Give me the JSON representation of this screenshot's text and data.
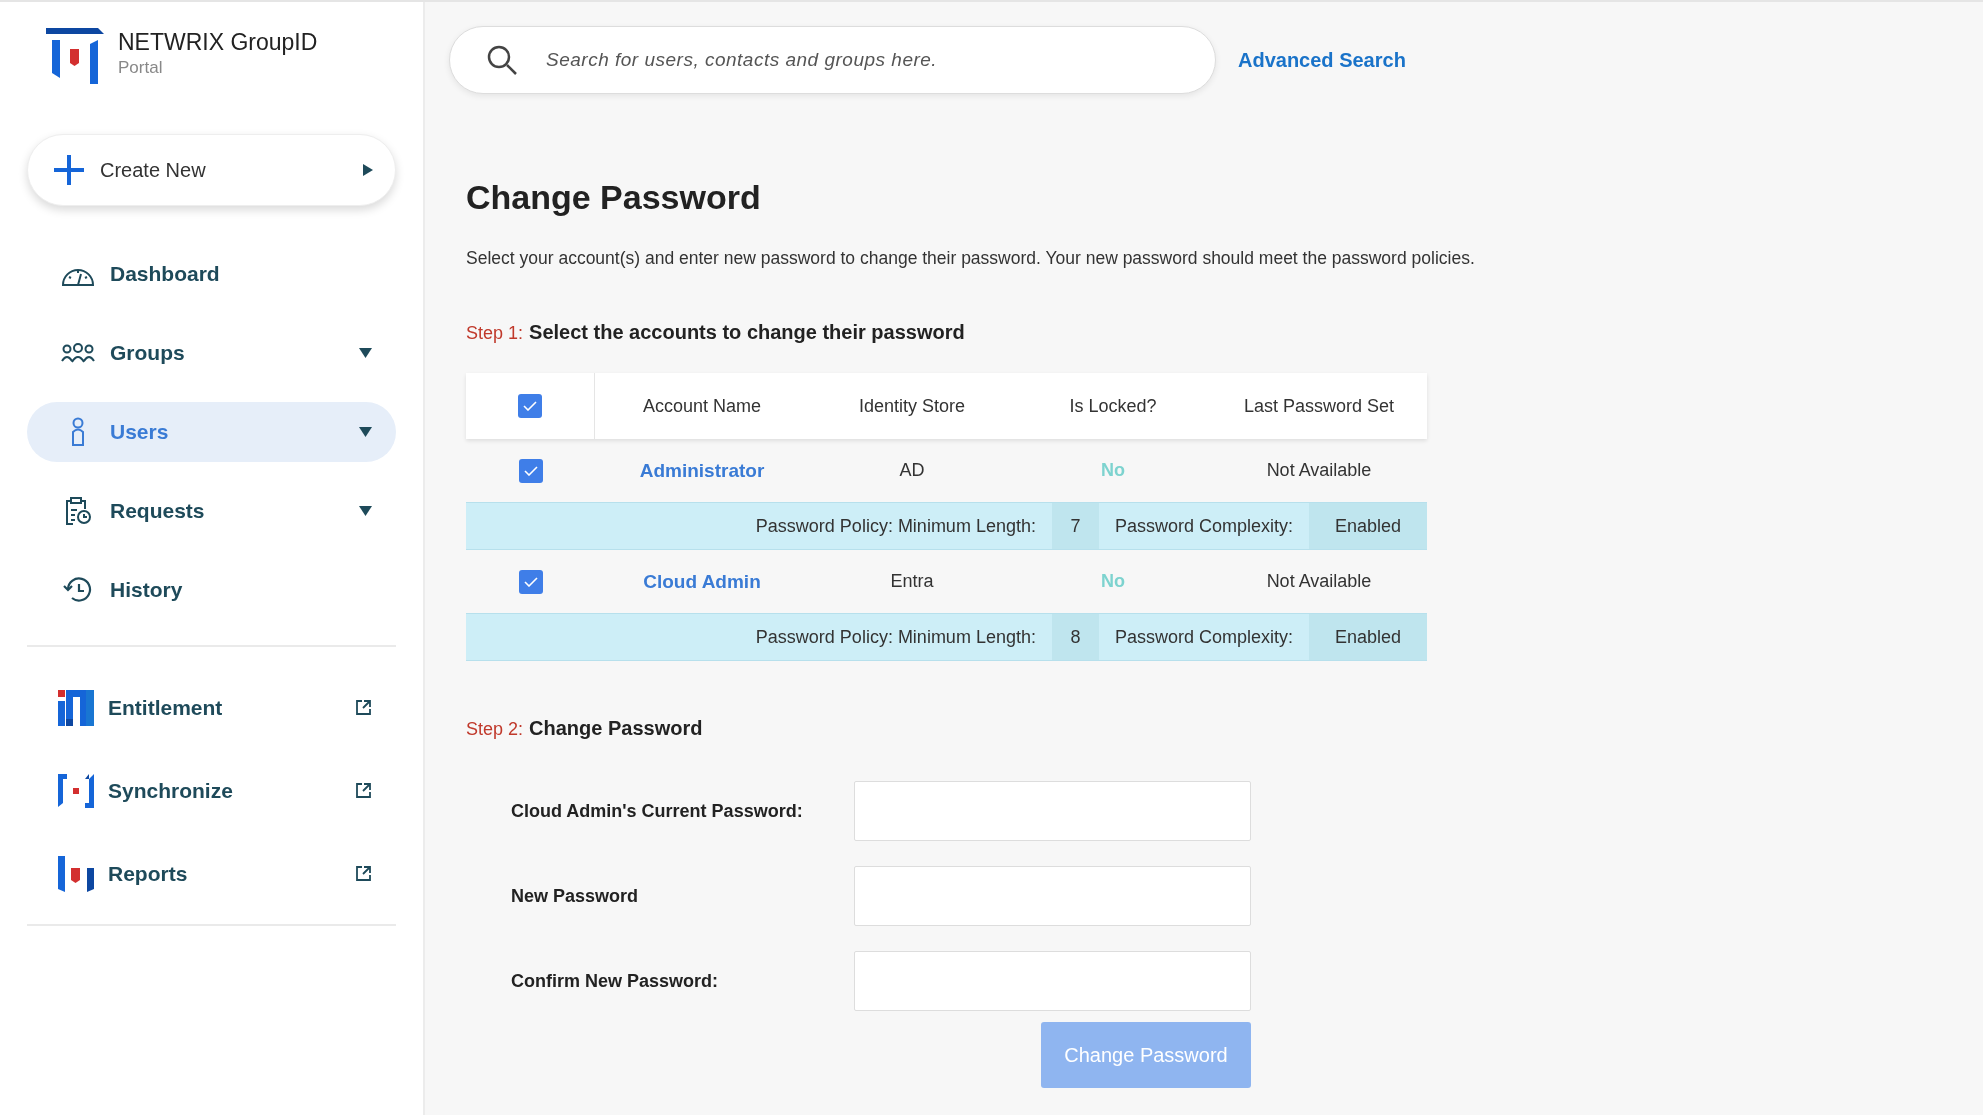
{
  "brand": {
    "title": "NETWRIX GroupID",
    "subtitle": "Portal"
  },
  "create_button": {
    "label": "Create New"
  },
  "sidebar": {
    "items": [
      {
        "label": "Dashboard",
        "kind": "dashboard",
        "selected": false
      },
      {
        "label": "Groups",
        "kind": "groups",
        "selected": false,
        "expandable": true
      },
      {
        "label": "Users",
        "kind": "users",
        "selected": true,
        "expandable": true
      },
      {
        "label": "Requests",
        "kind": "requests",
        "selected": false,
        "expandable": true
      },
      {
        "label": "History",
        "kind": "history",
        "selected": false
      }
    ],
    "apps": [
      {
        "label": "Entitlement",
        "kind": "entitlement"
      },
      {
        "label": "Synchronize",
        "kind": "synchronize"
      },
      {
        "label": "Reports",
        "kind": "reports"
      }
    ]
  },
  "search": {
    "placeholder": "Search for users, contacts and groups here.",
    "advanced_link": "Advanced Search"
  },
  "page": {
    "title": "Change Password",
    "description": "Select your account(s) and enter new password to change their password. Your new password should meet the password policies."
  },
  "step1": {
    "step": "Step 1:",
    "title": "Select the accounts to change their password"
  },
  "table": {
    "select_all_checked": true,
    "columns": [
      "Account Name",
      "Identity Store",
      "Is Locked?",
      "Last Password Set"
    ],
    "rows": [
      {
        "checked": true,
        "account_name": "Administrator",
        "identity_store": "AD",
        "is_locked": "No",
        "last_password_set": "Not Available",
        "policy_label": "Password Policy: Minimum Length:",
        "min_length": "7",
        "complexity_label": "Password Complexity:",
        "complexity": "Enabled"
      },
      {
        "checked": true,
        "account_name": "Cloud Admin",
        "identity_store": "Entra",
        "is_locked": "No",
        "last_password_set": "Not Available",
        "policy_label": "Password Policy: Minimum Length:",
        "min_length": "8",
        "complexity_label": "Password Complexity:",
        "complexity": "Enabled"
      }
    ]
  },
  "step2": {
    "step": "Step 2:",
    "title": "Change Password"
  },
  "form": {
    "fields": [
      {
        "label": "Cloud Admin's Current Password:"
      },
      {
        "label": "New Password"
      },
      {
        "label": "Confirm New Password:"
      }
    ],
    "submit": {
      "label": "Change Password",
      "disabled": true
    }
  }
}
